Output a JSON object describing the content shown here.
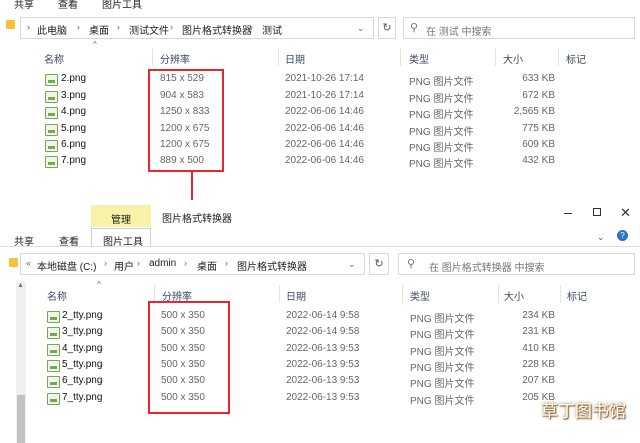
{
  "top": {
    "tabs": [
      "共享",
      "查看",
      "图片工具"
    ],
    "breadcrumb": [
      "此电脑",
      "桌面",
      "测试文件",
      "图片格式转换器",
      "测试"
    ],
    "search_placeholder": "在 测试 中搜索",
    "columns": [
      "名称",
      "分辨率",
      "日期",
      "类型",
      "大小",
      "标记"
    ],
    "files": [
      {
        "name": "2.png",
        "res": "815 x 529",
        "date": "2021-10-26 17:14",
        "type": "PNG 图片文件",
        "size": "633 KB"
      },
      {
        "name": "3.png",
        "res": "904 x 583",
        "date": "2021-10-26 17:14",
        "type": "PNG 图片文件",
        "size": "672 KB"
      },
      {
        "name": "4.png",
        "res": "1250 x 833",
        "date": "2022-06-06 14:46",
        "type": "PNG 图片文件",
        "size": "2,565 KB"
      },
      {
        "name": "5.png",
        "res": "1200 x 675",
        "date": "2022-06-06 14:46",
        "type": "PNG 图片文件",
        "size": "775 KB"
      },
      {
        "name": "6.png",
        "res": "1200 x 675",
        "date": "2022-06-06 14:46",
        "type": "PNG 图片文件",
        "size": "609 KB"
      },
      {
        "name": "7.png",
        "res": "889 x 500",
        "date": "2022-06-06 14:46",
        "type": "PNG 图片文件",
        "size": "432 KB"
      }
    ]
  },
  "bottom": {
    "ribbon_manage": "管理",
    "window_title": "图片格式转换器",
    "tabs": [
      "共享",
      "查看",
      "图片工具"
    ],
    "breadcrumb": [
      "本地磁盘 (C:)",
      "用户",
      "admin",
      "桌面",
      "图片格式转换器"
    ],
    "search_placeholder": "在 图片格式转换器 中搜索",
    "columns": [
      "名称",
      "分辨率",
      "日期",
      "类型",
      "大小",
      "标记"
    ],
    "files": [
      {
        "name": "2_tty.png",
        "res": "500 x 350",
        "date": "2022-06-14 9:58",
        "type": "PNG 图片文件",
        "size": "234 KB"
      },
      {
        "name": "3_tty.png",
        "res": "500 x 350",
        "date": "2022-06-14 9:58",
        "type": "PNG 图片文件",
        "size": "231 KB"
      },
      {
        "name": "4_tty.png",
        "res": "500 x 350",
        "date": "2022-06-13 9:53",
        "type": "PNG 图片文件",
        "size": "410 KB"
      },
      {
        "name": "5_tty.png",
        "res": "500 x 350",
        "date": "2022-06-13 9:53",
        "type": "PNG 图片文件",
        "size": "228 KB"
      },
      {
        "name": "6_tty.png",
        "res": "500 x 350",
        "date": "2022-06-13 9:53",
        "type": "PNG 图片文件",
        "size": "207 KB"
      },
      {
        "name": "7_tty.png",
        "res": "500 x 350",
        "date": "2022-06-13 9:53",
        "type": "PNG 图片文件",
        "size": "205 KB"
      }
    ]
  },
  "watermark": "草丁图书馆",
  "colors": {
    "highlight": "#e8262b",
    "manage_tab": "#f8f1a8",
    "icon_green": "#7aa35b"
  }
}
